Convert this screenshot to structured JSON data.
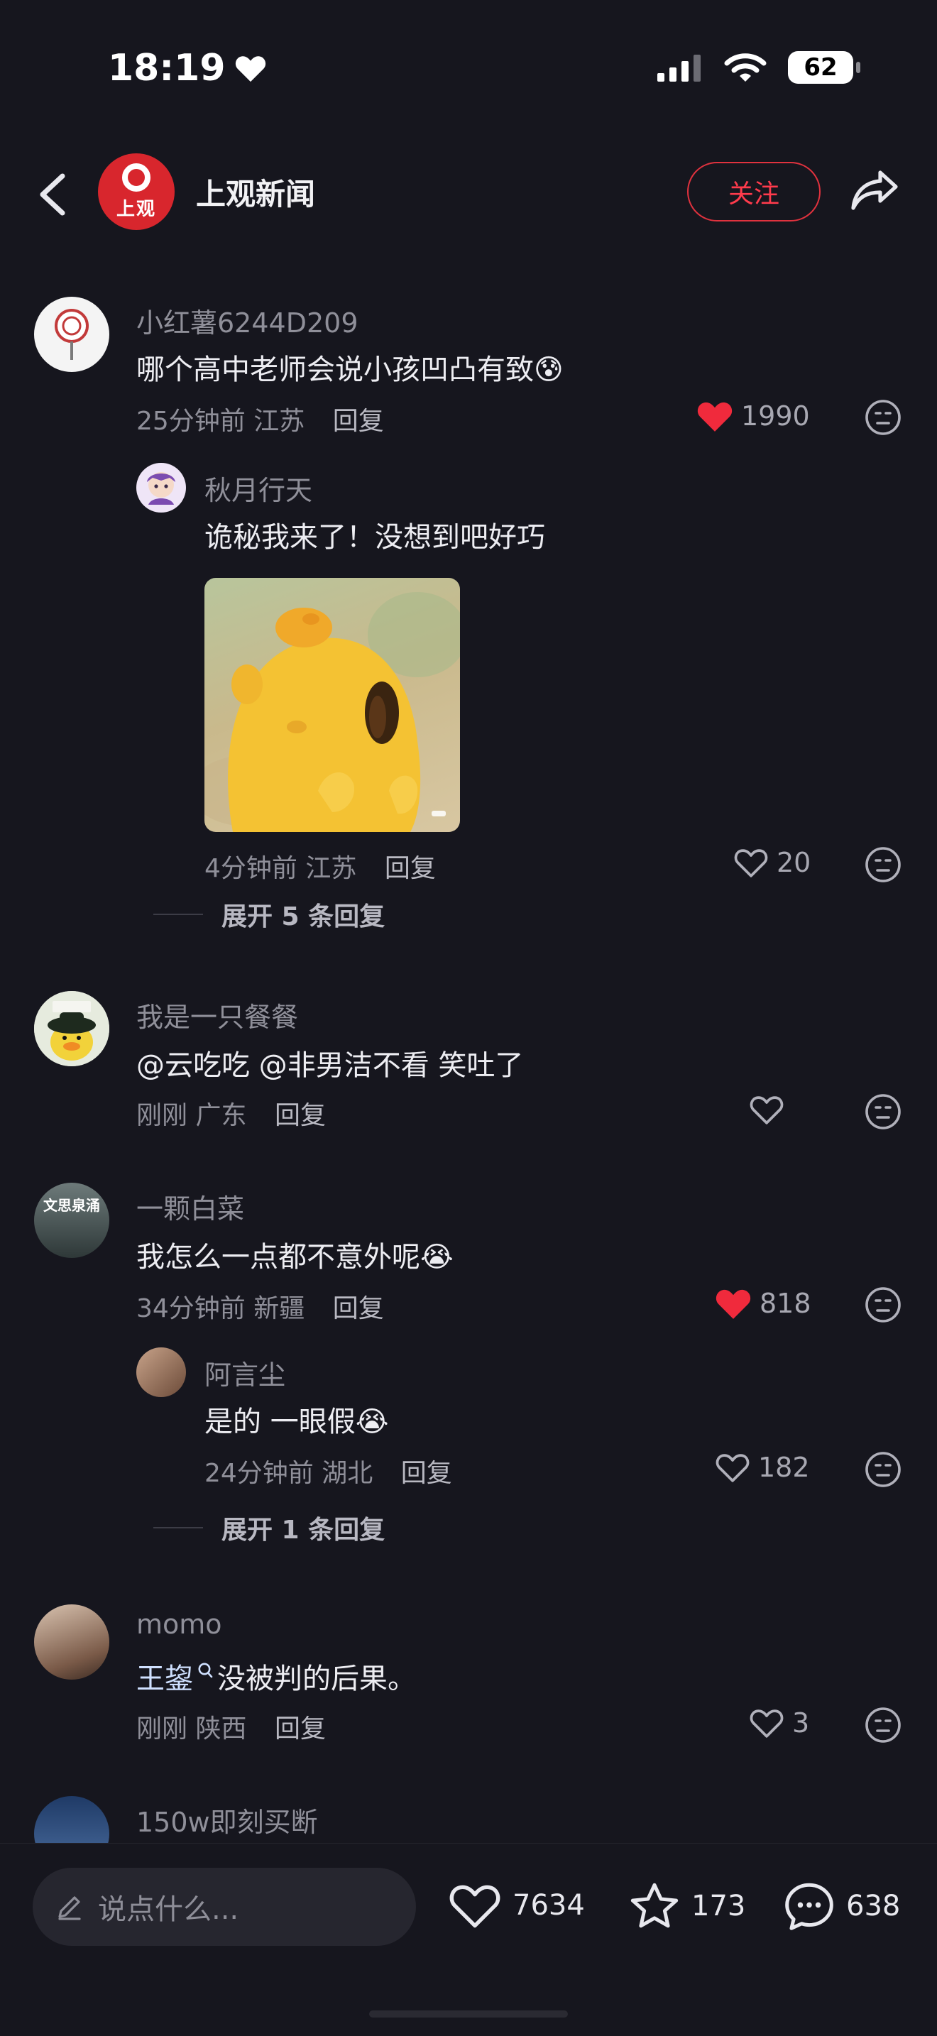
{
  "status_bar": {
    "time": "18:19",
    "battery": "62"
  },
  "header": {
    "account_name": "上观新闻",
    "logo_text": "上观",
    "follow_label": "关注"
  },
  "comments": [
    {
      "user": "小红薯6244D209",
      "text": "哪个高中老师会说小孩凹凸有致",
      "emoji": "😰",
      "time": "25分钟前",
      "location": "江苏",
      "reply_label": "回复",
      "likes": "1990",
      "liked": true,
      "replies": [
        {
          "user": "秋月行天",
          "text": "诡秘我来了！没想到吧好巧",
          "time": "4分钟前",
          "location": "江苏",
          "reply_label": "回复",
          "likes": "20",
          "liked": false
        }
      ],
      "expand_label": "展开 5 条回复"
    },
    {
      "user": "我是一只餐餐",
      "text": "@云吃吃 @非男洁不看 笑吐了",
      "time": "刚刚",
      "location": "广东",
      "reply_label": "回复",
      "likes": "",
      "liked": false
    },
    {
      "user": "一颗白菜",
      "avatar_text": "文思泉涌",
      "text": "我怎么一点都不意外呢",
      "emoji": "😭",
      "time": "34分钟前",
      "location": "新疆",
      "reply_label": "回复",
      "likes": "818",
      "liked": true,
      "replies": [
        {
          "user": "阿言尘",
          "text": "是的 一眼假",
          "emoji": "😭",
          "time": "24分钟前",
          "location": "湖北",
          "reply_label": "回复",
          "likes": "182",
          "liked": false
        }
      ],
      "expand_label": "展开 1 条回复"
    },
    {
      "user": "momo",
      "text": "王鋆",
      "text_after": "没被判的后果。",
      "time": "刚刚",
      "location": "陕西",
      "reply_label": "回复",
      "likes": "3",
      "liked": false
    },
    {
      "user": "150w即刻买断"
    }
  ],
  "bottom_bar": {
    "input_placeholder": "说点什么...",
    "likes": "7634",
    "favorites": "173",
    "comments": "638"
  },
  "colors": {
    "background": "#16161e",
    "accent_red": "#ff3b4c",
    "like_red": "#f02a3c",
    "text_primary": "#ededf2",
    "text_secondary": "#8f8f99"
  },
  "icons": [
    "heart-icon",
    "signal-icon",
    "wifi-icon",
    "back-arrow-icon",
    "share-icon",
    "face-icon",
    "pencil-icon",
    "star-icon",
    "chat-icon"
  ]
}
